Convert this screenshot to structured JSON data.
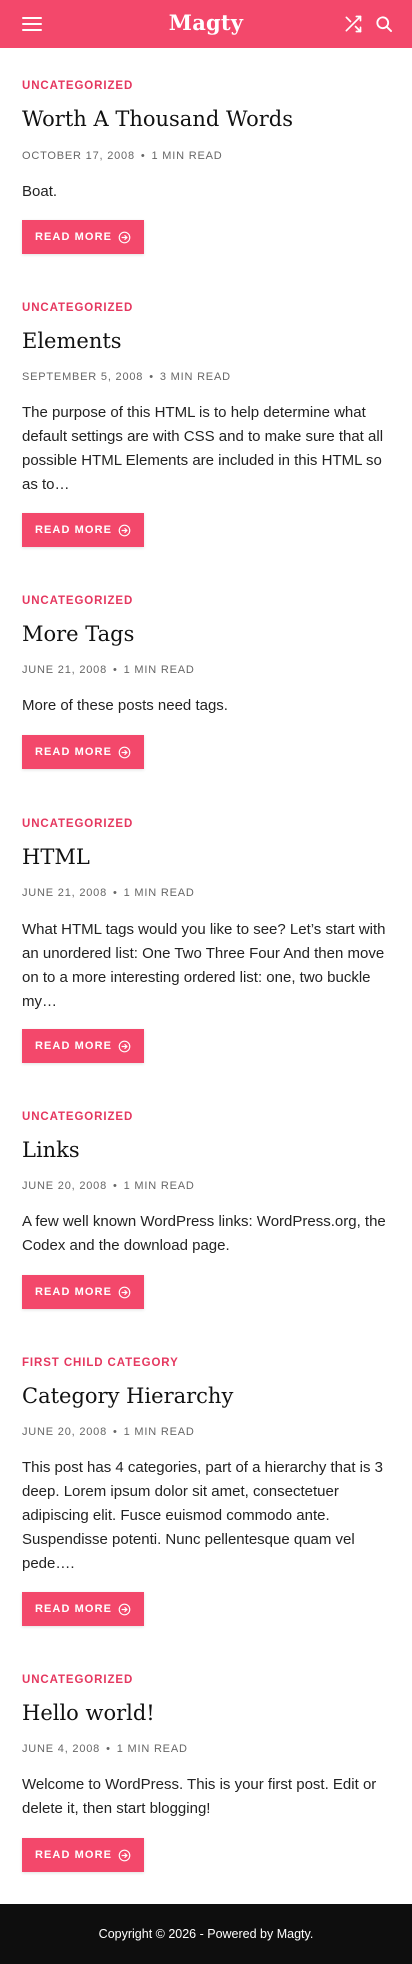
{
  "header": {
    "site_title": "Magty",
    "icons": [
      "menu-icon",
      "shuffle-icon",
      "search-icon"
    ],
    "accent": "#f3486b"
  },
  "posts": [
    {
      "category": "Uncategorized",
      "title": "Worth A Thousand Words",
      "date": "October 17, 2008",
      "read_time": "1 min read",
      "excerpt": "Boat.",
      "button": "Read More"
    },
    {
      "category": "Uncategorized",
      "title": "Elements",
      "date": "September 5, 2008",
      "read_time": "3 min read",
      "excerpt": "The purpose of this HTML is to help determine what default settings are with CSS and to make sure that all possible HTML Elements are included in this HTML so as to…",
      "button": "Read More"
    },
    {
      "category": "Uncategorized",
      "title": "More Tags",
      "date": "June 21, 2008",
      "read_time": "1 min read",
      "excerpt": "More of these posts need tags.",
      "button": "Read More"
    },
    {
      "category": "Uncategorized",
      "title": "HTML",
      "date": "June 21, 2008",
      "read_time": "1 min read",
      "excerpt": "What HTML tags would you like to see? Let’s start with an unordered list: One Two Three Four And then move on to a more interesting ordered list: one, two buckle my…",
      "button": "Read More"
    },
    {
      "category": "Uncategorized",
      "title": "Links",
      "date": "June 20, 2008",
      "read_time": "1 min read",
      "excerpt": "A few well known WordPress links: WordPress.org, the Codex and the download page.",
      "button": "Read More"
    },
    {
      "category": "First Child Category",
      "title": "Category Hierarchy",
      "date": "June 20, 2008",
      "read_time": "1 min read",
      "excerpt": "This post has 4 categories, part of a hierarchy that is 3 deep. Lorem ipsum dolor sit amet, consectetuer adipiscing elit. Fusce euismod commodo ante. Suspendisse potenti. Nunc pellentesque quam vel pede….",
      "button": "Read More"
    },
    {
      "category": "Uncategorized",
      "title": "Hello world!",
      "date": "June 4, 2008",
      "read_time": "1 min read",
      "excerpt": "Welcome to WordPress. This is your first post. Edit or delete it, then start blogging!",
      "button": "Read More"
    }
  ],
  "footer": {
    "text": "Copyright © 2026 - Powered by Magty."
  }
}
